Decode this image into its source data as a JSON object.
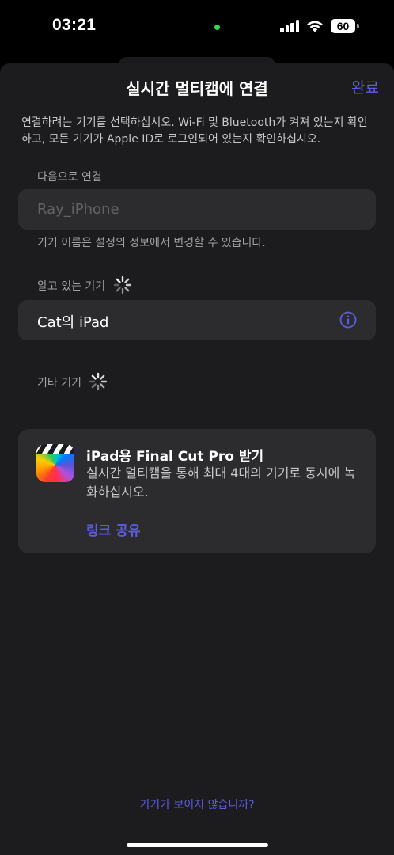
{
  "status_bar": {
    "time": "03:21",
    "battery": "60",
    "icons": [
      "camera-in-use-dot",
      "cellular-signal-icon",
      "wifi-icon",
      "battery-icon"
    ]
  },
  "header": {
    "title": "실시간 멀티캠에 연결",
    "done_label": "완료"
  },
  "description": "연결하려는 기기를 선택하십시오. Wi-Fi 및 Bluetooth가 켜져 있는지 확인하고, 모든 기기가 Apple ID로 로그인되어 있는지 확인하십시오.",
  "connect_as": {
    "label": "다음으로 연결",
    "placeholder": "Ray_iPhone",
    "value": "",
    "helper": "기기 이름은 설정의 정보에서 변경할 수 있습니다."
  },
  "known_devices": {
    "label": "알고 있는 기기",
    "items": [
      {
        "name": "Cat의 iPad"
      }
    ]
  },
  "other_devices": {
    "label": "기타 기기"
  },
  "promo": {
    "title": "iPad용 Final Cut Pro 받기",
    "body": "실시간 멀티캠을 통해 최대 4대의 기기로 동시에 녹화하십시오.",
    "link": "링크 공유"
  },
  "footer_link": "기기가 보이지 않습니까?",
  "colors": {
    "accent": "#5e5ce6",
    "background": "#1c1c1e",
    "card": "#2c2c2e",
    "camera_dot": "#32d74b"
  }
}
